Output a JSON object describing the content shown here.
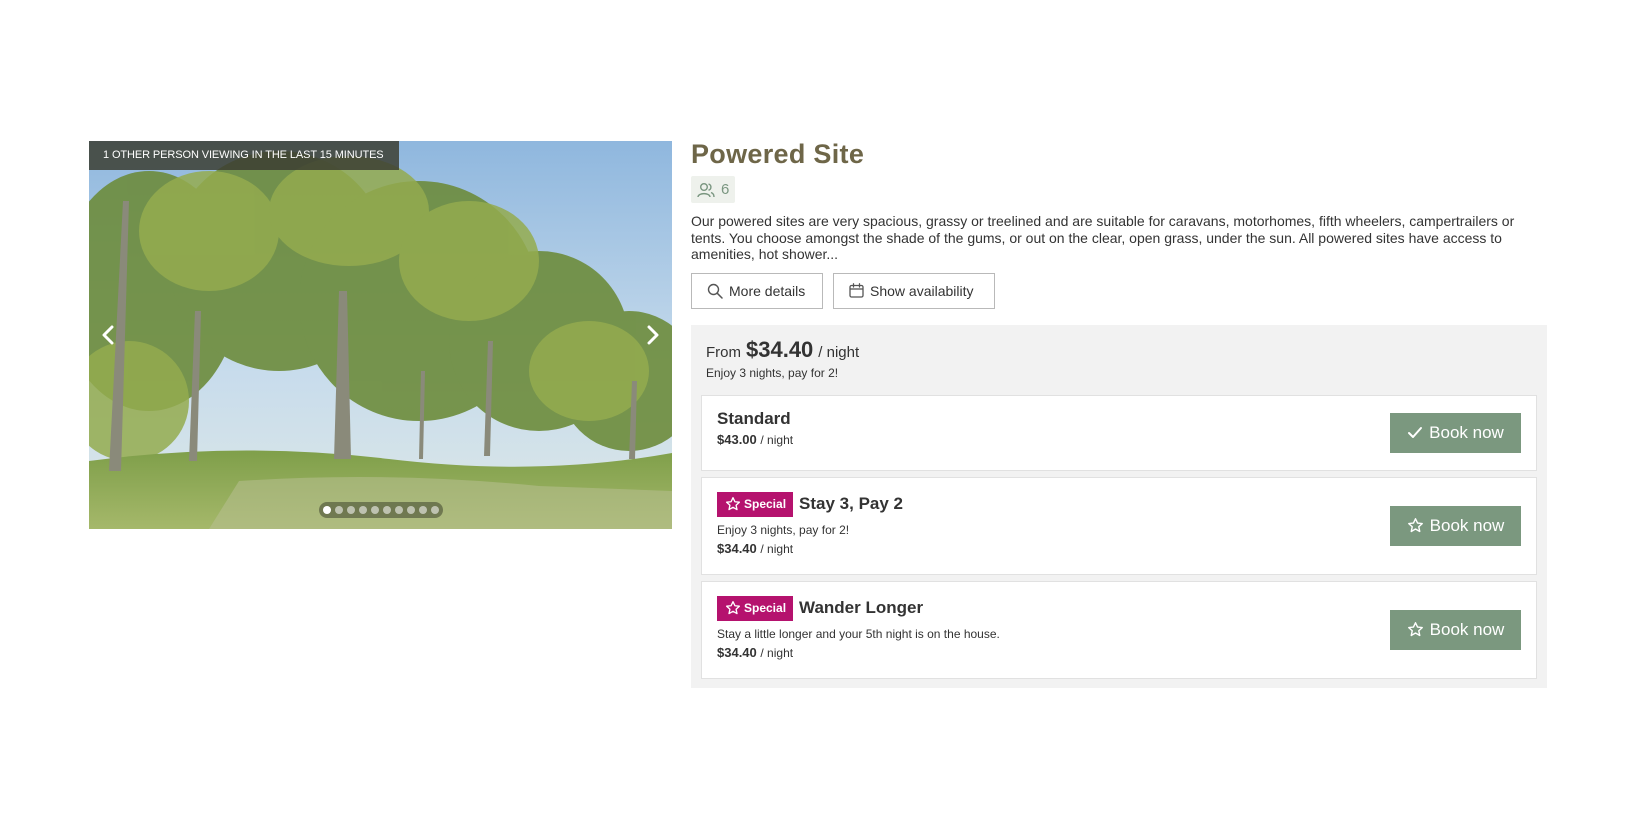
{
  "gallery": {
    "viewers_notice": "1 OTHER PERSON VIEWING IN THE LAST 15 MINUTES",
    "slide_count": 10,
    "active_slide": 1
  },
  "site": {
    "title": "Powered Site",
    "guests": "6",
    "description": "Our powered sites are very spacious, grassy or treelined and are suitable for caravans, motorhomes, fifth wheelers, campertrailers or tents. You choose amongst the shade of the gums, or out on the clear, open grass, under the sun. All powered sites have access to amenities, hot shower..."
  },
  "actions": {
    "more_details": "More details",
    "show_availability": "Show availability"
  },
  "pricing": {
    "from_label": "From",
    "from_price": "$34.40",
    "per_night": "/ night",
    "note": "Enjoy 3 nights, pay for 2!"
  },
  "rates": [
    {
      "name": "Standard",
      "price": "$43.00",
      "unit": "/ night",
      "book_label": "Book now",
      "book_icon": "check-icon"
    },
    {
      "badge": "Special",
      "name": "Stay 3, Pay 2",
      "subtitle": "Enjoy 3 nights, pay for 2!",
      "price": "$34.40",
      "unit": "/ night",
      "book_label": "Book now",
      "book_icon": "star-icon"
    },
    {
      "badge": "Special",
      "name": "Wander Longer",
      "subtitle": "Stay a little longer and your 5th night is on the house.",
      "price": "$34.40",
      "unit": "/ night",
      "book_label": "Book now",
      "book_icon": "star-icon"
    }
  ],
  "colors": {
    "title": "#6e6648",
    "accent_green": "#7b987f",
    "special_badge": "#b5126e",
    "rates_panel": "#f2f2f2"
  }
}
